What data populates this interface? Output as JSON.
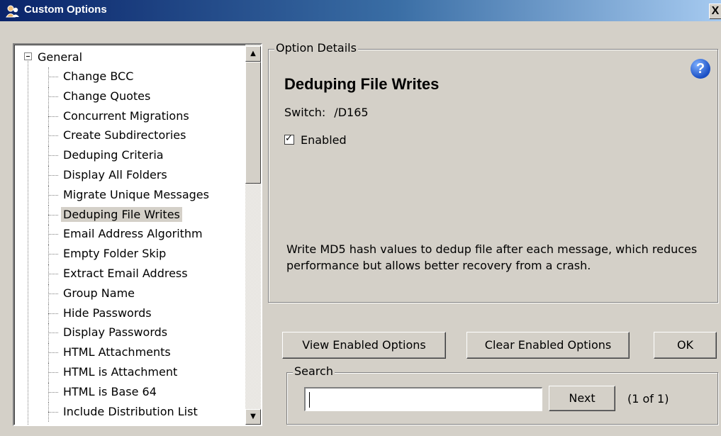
{
  "window": {
    "title": "Custom Options",
    "close_label": "X",
    "icon": "app-people-icon"
  },
  "tree": {
    "root_label": "General",
    "items": [
      "Change BCC",
      "Change Quotes",
      "Concurrent Migrations",
      "Create Subdirectories",
      "Deduping Criteria",
      "Display All Folders",
      "Migrate Unique Messages",
      "Deduping File Writes",
      "Email Address Algorithm",
      "Empty Folder Skip",
      "Extract Email Address",
      "Group Name",
      "Hide Passwords",
      "Display Passwords",
      "HTML Attachments",
      "HTML is Attachment",
      "HTML is Base 64",
      "Include Distribution List"
    ],
    "selected": "Deduping File Writes"
  },
  "details": {
    "group_label": "Option Details",
    "title": "Deduping File Writes",
    "switch_label": "Switch:",
    "switch_value": "/D165",
    "enabled_label": "Enabled",
    "enabled": true,
    "help_label": "?",
    "description": "Write MD5 hash values to dedup file after each message, which reduces performance but allows better recovery from a crash."
  },
  "buttons": {
    "view_enabled": "View Enabled Options",
    "clear_enabled": "Clear Enabled Options",
    "ok": "OK"
  },
  "search": {
    "group_label": "Search",
    "value": "",
    "next_label": "Next",
    "count": "(1 of 1)"
  }
}
